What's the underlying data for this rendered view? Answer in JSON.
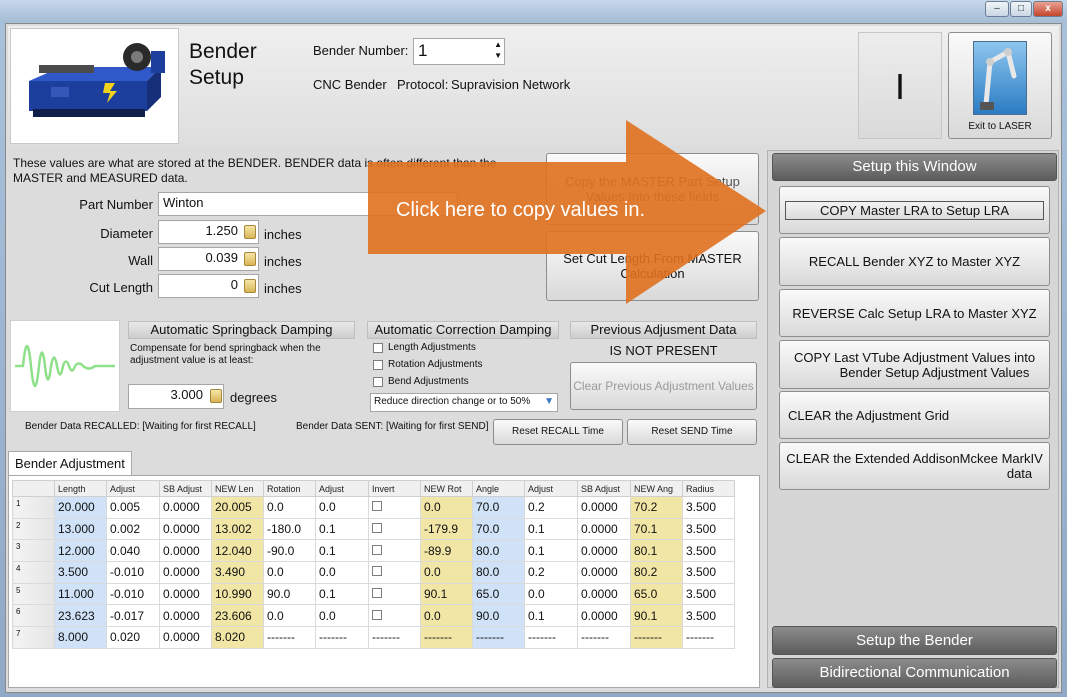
{
  "window": {
    "controls": {
      "minimize": "‒",
      "maximize": "□",
      "close": "x"
    }
  },
  "header": {
    "title_line1": "Bender",
    "title_line2": "Setup",
    "bender_number_label": "Bender Number:",
    "bender_number_value": "1",
    "bender_type": "CNC Bender",
    "protocol_label": "Protocol:",
    "protocol_value": "Supravision Network",
    "indicator_text": "I",
    "exit_label": "Exit to LASER"
  },
  "info_text": "These values are what are stored at the BENDER.  BENDER data is often different than the MASTER and MEASURED data.",
  "fields": {
    "part_number_label": "Part Number",
    "part_number_value": "Winton",
    "diameter_label": "Diameter",
    "diameter_value": "1.250",
    "diameter_unit": "inches",
    "wall_label": "Wall",
    "wall_value": "0.039",
    "wall_unit": "inches",
    "cut_length_label": "Cut Length",
    "cut_length_value": "0",
    "cut_length_unit": "inches"
  },
  "center_buttons": {
    "copy_master": "Copy the MASTER Part Setup Values Into these fields",
    "set_cut_length": "Set Cut Length From MASTER Calculation"
  },
  "callout_text": "Click here to copy values in.",
  "springback": {
    "title": "Automatic Springback Damping",
    "description": "Compensate for bend springback when the adjustment value is at least:",
    "value": "3.000",
    "unit": "degrees"
  },
  "correction": {
    "title": "Automatic Correction Damping",
    "length": "Length Adjustments",
    "rotation": "Rotation Adjustments",
    "bend": "Bend Adjustments",
    "mode_selected": "Reduce direction change or to 50%"
  },
  "previous": {
    "title": "Previous Adjusment Data",
    "status": "IS NOT PRESENT",
    "clear_button": "Clear Previous Adjustment Values"
  },
  "status": {
    "recalled": "Bender Data RECALLED: [Waiting for first RECALL]",
    "sent": "Bender Data SENT: [Waiting for first SEND]",
    "reset_recall": "Reset RECALL Time",
    "reset_send": "Reset SEND Time"
  },
  "tab_label": "Bender Adjustment",
  "grid": {
    "headers": [
      "",
      "Length",
      "Adjust",
      "SB Adjust",
      "NEW Len",
      "Rotation",
      "Adjust",
      "Invert",
      "NEW Rot",
      "Angle",
      "Adjust",
      "SB Adjust",
      "NEW Ang",
      "Radius"
    ],
    "rows": [
      [
        "1",
        "20.000",
        "0.005",
        "0.0000",
        "20.005",
        "0.0",
        "0.0",
        "",
        "0.0",
        "70.0",
        "0.2",
        "0.0000",
        "70.2",
        "3.500"
      ],
      [
        "2",
        "13.000",
        "0.002",
        "0.0000",
        "13.002",
        "-180.0",
        "0.1",
        "",
        "-179.9",
        "70.0",
        "0.1",
        "0.0000",
        "70.1",
        "3.500"
      ],
      [
        "3",
        "12.000",
        "0.040",
        "0.0000",
        "12.040",
        "-90.0",
        "0.1",
        "",
        "-89.9",
        "80.0",
        "0.1",
        "0.0000",
        "80.1",
        "3.500"
      ],
      [
        "4",
        "3.500",
        "-0.010",
        "0.0000",
        "3.490",
        "0.0",
        "0.0",
        "",
        "0.0",
        "80.0",
        "0.2",
        "0.0000",
        "80.2",
        "3.500"
      ],
      [
        "5",
        "11.000",
        "-0.010",
        "0.0000",
        "10.990",
        "90.0",
        "0.1",
        "",
        "90.1",
        "65.0",
        "0.0",
        "0.0000",
        "65.0",
        "3.500"
      ],
      [
        "6",
        "23.623",
        "-0.017",
        "0.0000",
        "23.606",
        "0.0",
        "0.0",
        "",
        "0.0",
        "90.0",
        "0.1",
        "0.0000",
        "90.1",
        "3.500"
      ],
      [
        "7",
        "8.000",
        "0.020",
        "0.0000",
        "8.020",
        "-------",
        "-------",
        "-------",
        "-------",
        "-------",
        "-------",
        "-------",
        "-------",
        "-------"
      ]
    ]
  },
  "right_panel": {
    "setup_window": "Setup this Window",
    "copy_master_lra": "COPY Master LRA to Setup LRA",
    "recall_xyz": "RECALL Bender XYZ to Master XYZ",
    "reverse_calc": "REVERSE Calc Setup LRA to Master XYZ",
    "copy_vtube_line1": "COPY Last VTube Adjustment Values into",
    "copy_vtube_line2": "Bender Setup Adjustment Values",
    "clear_grid": "CLEAR the Adjustment Grid",
    "clear_addison_line1": "CLEAR the Extended AddisonMckee MarkIV",
    "clear_addison_line2": "data",
    "setup_bender": "Setup the Bender",
    "bidirectional": "Bidirectional Communication"
  },
  "colors": {
    "arrow": "#e0711f",
    "grid_blue": "#cfe2f7",
    "grid_yellow": "#f2e6a6"
  }
}
